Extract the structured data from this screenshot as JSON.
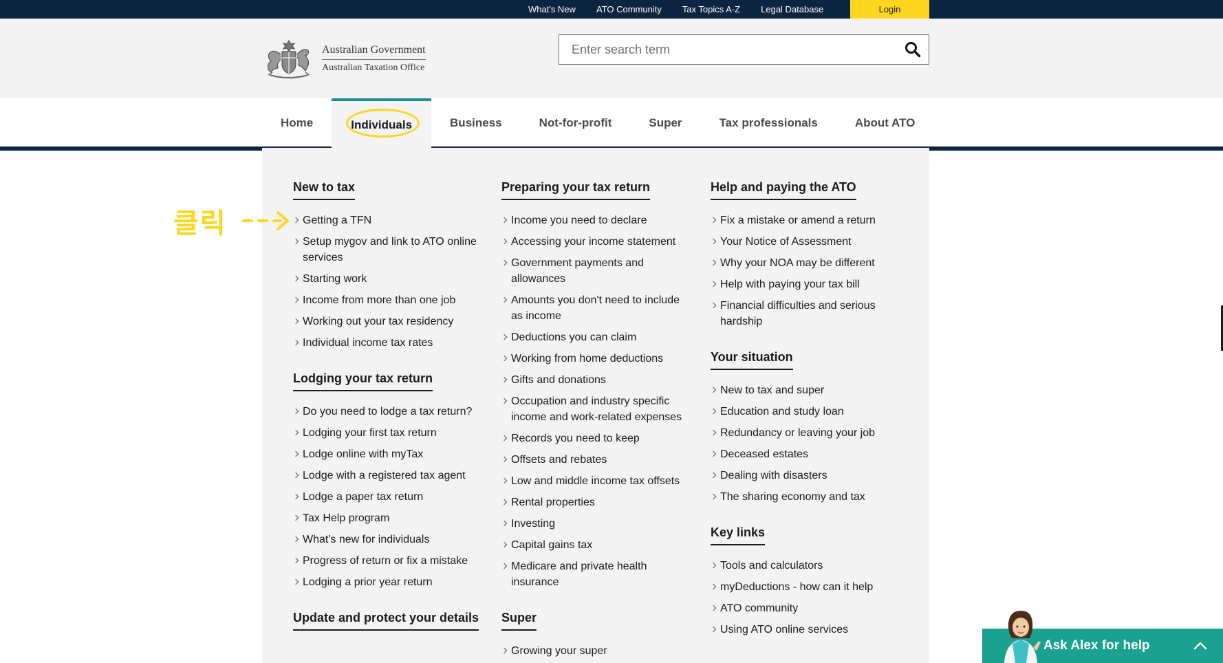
{
  "topbar": {
    "links": [
      "What's New",
      "ATO Community",
      "Tax Topics A-Z",
      "Legal Database"
    ],
    "login_label": "Login",
    "accent_color": "#ffd61f",
    "background_color": "#0b2440"
  },
  "header": {
    "logo_line1": "Australian Government",
    "logo_line2": "Australian Taxation Office",
    "logo_icon": "coat-of-arms-icon",
    "search_placeholder": "Enter search term",
    "search_value": "",
    "search_icon": "search-icon"
  },
  "nav": {
    "items": [
      "Home",
      "Individuals",
      "Business",
      "Not-for-profit",
      "Super",
      "Tax professionals",
      "About ATO"
    ],
    "active": "Individuals",
    "active_accent_color": "#1c8c9a"
  },
  "menu": {
    "columns": [
      {
        "sections": [
          {
            "title": "New to tax",
            "links": [
              "Getting a TFN",
              "Setup mygov and link to ATO online services",
              "Starting work",
              "Income from more than one job",
              "Working out your tax residency",
              "Individual income tax rates"
            ]
          },
          {
            "title": "Lodging your tax return",
            "links": [
              "Do you need to lodge a tax return?",
              "Lodging your first tax return",
              "Lodge online with myTax",
              "Lodge with a registered tax agent",
              "Lodge a paper tax return",
              "Tax Help program",
              "What's new for individuals",
              "Progress of return or fix a mistake",
              "Lodging a prior year return"
            ]
          },
          {
            "title": "Update and protect your details",
            "links": []
          }
        ]
      },
      {
        "sections": [
          {
            "title": "Preparing your tax return",
            "links": [
              "Income you need to declare",
              "Accessing your income statement",
              "Government payments and allowances",
              "Amounts you don't need to include as income",
              "Deductions you can claim",
              "Working from home deductions",
              "Gifts and donations",
              "Occupation and industry specific income and work-related expenses",
              "Records you need to keep",
              "Offsets and rebates",
              "Low and middle income tax offsets",
              "Rental properties",
              "Investing",
              "Capital gains tax",
              "Medicare and private health insurance"
            ]
          },
          {
            "title": "Super",
            "links": [
              "Growing your super"
            ]
          }
        ]
      },
      {
        "sections": [
          {
            "title": "Help and paying the ATO",
            "links": [
              "Fix a mistake or amend a return",
              "Your Notice of Assessment",
              "Why your NOA may be different",
              "Help with paying your tax bill",
              "Financial difficulties and serious hardship"
            ]
          },
          {
            "title": "Your situation",
            "links": [
              "New to tax and super",
              "Education and study loan",
              "Redundancy or leaving your job",
              "Deceased estates",
              "Dealing with disasters",
              "The sharing economy and tax"
            ]
          },
          {
            "title": "Key links",
            "links": [
              "Tools and calculators",
              "myDeductions - how can it help",
              "ATO community",
              "Using ATO online services"
            ]
          }
        ]
      }
    ]
  },
  "annotation": {
    "label": "클릭",
    "color": "#ffd61f"
  },
  "chat": {
    "label": "Ask Alex for help",
    "background_color": "#1aa18f",
    "avatar_icon": "assistant-avatar-icon",
    "chevron_icon": "chevron-up-icon"
  }
}
